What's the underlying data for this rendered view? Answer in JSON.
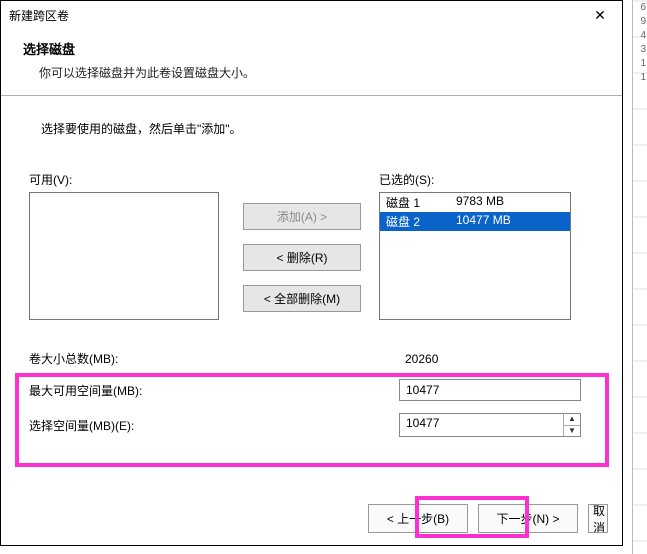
{
  "dialog": {
    "title": "新建跨区卷",
    "close_glyph": "✕"
  },
  "header": {
    "title": "选择磁盘",
    "subtitle": "你可以选择磁盘并为此卷设置磁盘大小。"
  },
  "instruction": "选择要使用的磁盘，然后单击\"添加\"。",
  "labels": {
    "available": "可用(V):",
    "selected": "已选的(S):",
    "add": "添加(A) >",
    "remove": "< 删除(R)",
    "remove_all": "< 全部删除(M)",
    "total_size": "卷大小总数(MB):",
    "max_space": "最大可用空间量(MB):",
    "select_space": "选择空间量(MB)(E):",
    "back": "< 上一步(B)",
    "next": "下一步(N) >",
    "cancel": "取消"
  },
  "available_disks": [],
  "selected_disks": [
    {
      "name": "磁盘 1",
      "size": "9783 MB",
      "selected": false
    },
    {
      "name": "磁盘 2",
      "size": "10477 MB",
      "selected": true
    }
  ],
  "values": {
    "total_size": "20260",
    "max_space": "10477",
    "select_space": "10477"
  },
  "side_numbers": [
    "6",
    "9",
    "4",
    "3",
    "1",
    "1"
  ]
}
